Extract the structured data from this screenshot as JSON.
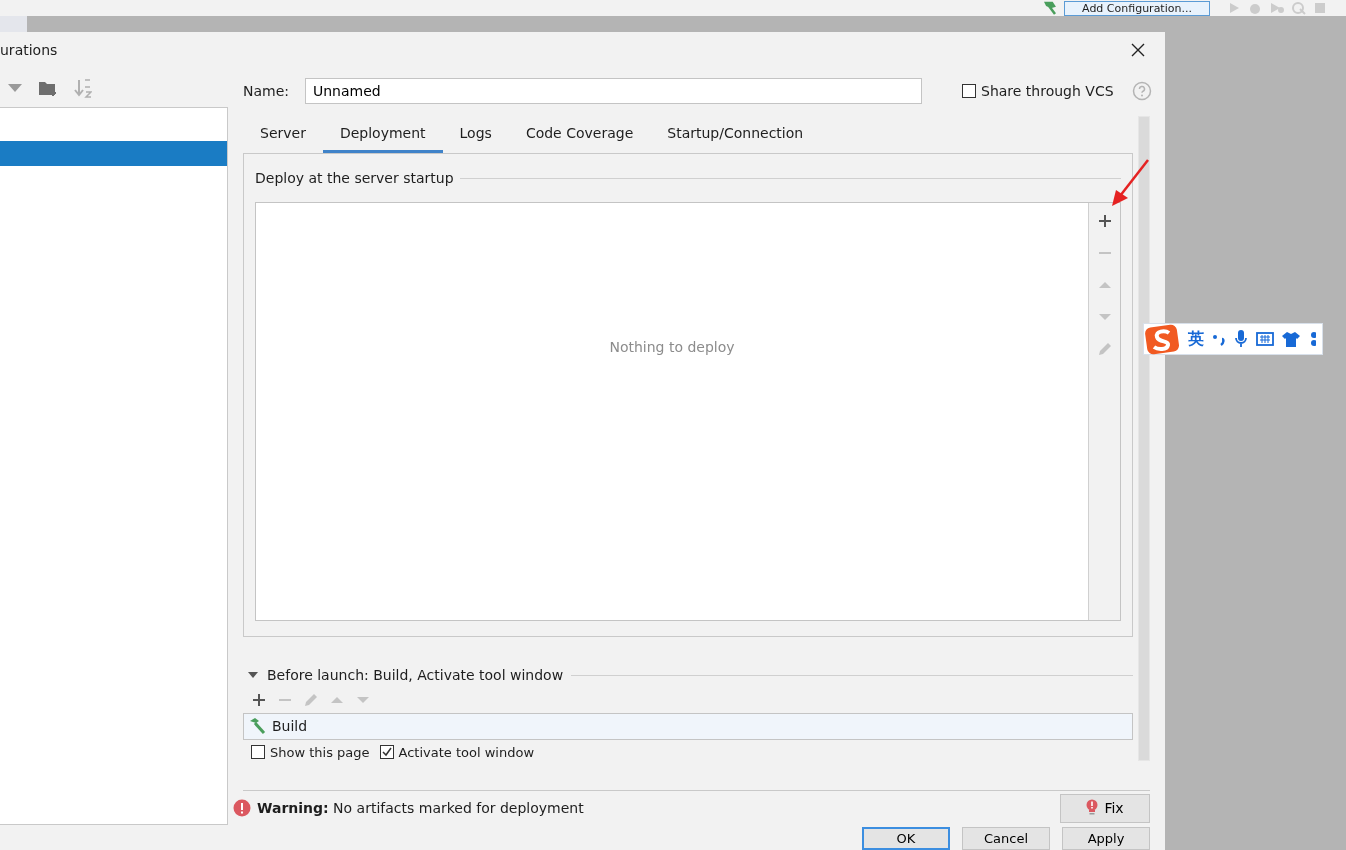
{
  "toolbar": {
    "add_configuration": "Add Configuration..."
  },
  "dialog": {
    "title": "urations",
    "tree_rows": [
      {
        "selected": false
      },
      {
        "selected": true
      }
    ],
    "name": {
      "label": "Name:",
      "value": "Unnamed"
    },
    "share": {
      "label": "Share through VCS",
      "checked": false
    },
    "tabs": [
      {
        "label": "Server",
        "selected": false
      },
      {
        "label": "Deployment",
        "selected": true
      },
      {
        "label": "Logs",
        "selected": false
      },
      {
        "label": "Code Coverage",
        "selected": false
      },
      {
        "label": "Startup/Connection",
        "selected": false
      }
    ],
    "deploy": {
      "title": "Deploy at the server startup",
      "empty_text": "Nothing to deploy",
      "tools": [
        {
          "kind": "add",
          "disabled": false
        },
        {
          "kind": "remove",
          "disabled": true
        },
        {
          "kind": "up",
          "disabled": true
        },
        {
          "kind": "down",
          "disabled": true
        },
        {
          "kind": "edit",
          "disabled": true
        }
      ]
    },
    "before_launch": {
      "title": "Before launch: Build, Activate tool window",
      "expanded": true,
      "tools": [
        {
          "kind": "add",
          "disabled": false
        },
        {
          "kind": "remove",
          "disabled": true
        },
        {
          "kind": "edit",
          "disabled": true
        },
        {
          "kind": "up",
          "disabled": true
        },
        {
          "kind": "down",
          "disabled": true
        }
      ],
      "tasks": [
        {
          "label": "Build"
        }
      ]
    },
    "show_page": {
      "label": "Show this page",
      "checked": false
    },
    "activate": {
      "label": "Activate tool window",
      "checked": true
    },
    "warning": "**Warning:** No artifacts marked for deployment",
    "fix_button": "Fix",
    "buttons": [
      {
        "label": "OK",
        "default": true
      },
      {
        "label": "Cancel",
        "default": false
      },
      {
        "label": "Apply",
        "default": false
      }
    ]
  },
  "ime": {
    "mode": "英"
  }
}
